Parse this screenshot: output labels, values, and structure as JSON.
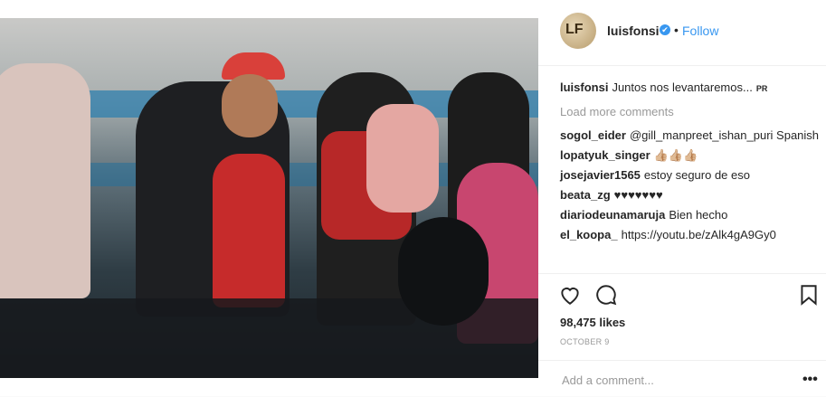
{
  "header": {
    "avatar_text": "LF",
    "username": "luisfonsi",
    "verified_icon": "✔",
    "separator": "•",
    "follow_label": "Follow"
  },
  "caption": {
    "username": "luisfonsi",
    "text": "Juntos nos levantaremos...",
    "badge": "PR"
  },
  "load_more_label": "Load more comments",
  "comments": [
    {
      "user": "sogol_eider",
      "text": "@gill_manpreet_ishan_puri Spanish"
    },
    {
      "user": "lopatyuk_singer",
      "text": "👍🏼👍🏼👍🏼"
    },
    {
      "user": "josejavier1565",
      "text": "estoy seguro de eso"
    },
    {
      "user": "beata_zg",
      "text": "♥♥♥♥♥♥♥"
    },
    {
      "user": "diariodeunamaruja",
      "text": "Bien hecho"
    },
    {
      "user": "el_koopa_",
      "text": "https://youtu.be/zAlk4gA9Gy0"
    }
  ],
  "likes_label": "98,475 likes",
  "date_label": "OCTOBER 9",
  "add_comment_placeholder": "Add a comment...",
  "more_label": "•••",
  "icons": [
    "heart-icon",
    "comment-icon",
    "bookmark-icon"
  ]
}
